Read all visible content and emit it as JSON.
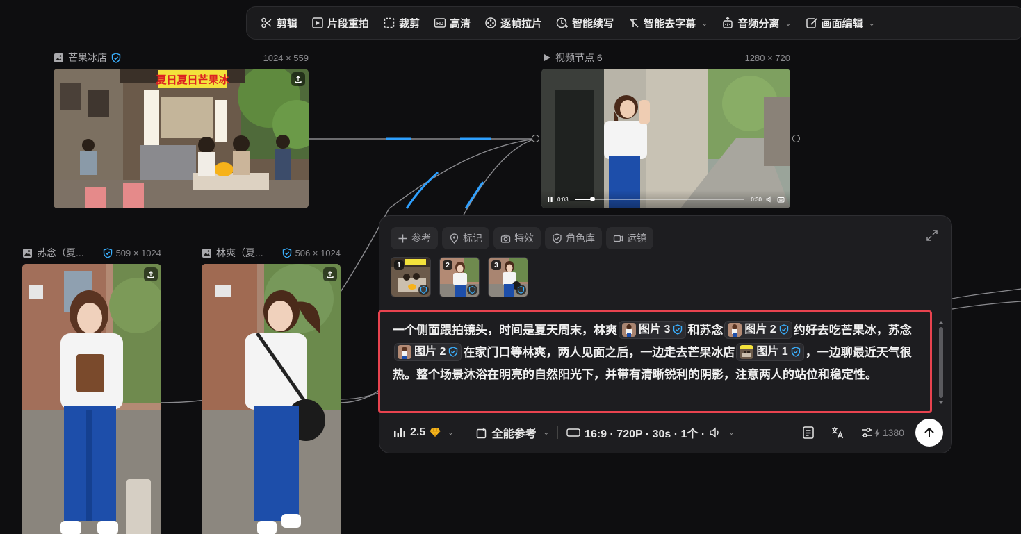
{
  "toolbar": {
    "items": [
      {
        "label": "剪辑",
        "icon": "scissors-icon"
      },
      {
        "label": "片段重拍",
        "icon": "reshoot-icon"
      },
      {
        "label": "裁剪",
        "icon": "crop-icon"
      },
      {
        "label": "高清",
        "icon": "hd-icon"
      },
      {
        "label": "逐帧拉片",
        "icon": "frame-icon"
      },
      {
        "label": "智能续写",
        "icon": "continue-icon"
      },
      {
        "label": "智能去字幕",
        "icon": "remove-subtitle-icon",
        "caret": "⌄"
      },
      {
        "label": "音频分离",
        "icon": "audio-separate-icon",
        "caret": "⌄"
      },
      {
        "label": "画面编辑",
        "icon": "edit-icon",
        "caret": "⌄"
      }
    ]
  },
  "nodes": {
    "mango_shop": {
      "title": "芒果冰店",
      "dims": "1024 × 559",
      "signage": "夏日夏日芒果冰"
    },
    "video": {
      "title": "视频节点 6",
      "dims": "1280 × 720",
      "time_current": "0:03",
      "time_total": "0:30",
      "progress": 0.1
    },
    "sunian": {
      "title": "苏念（夏...",
      "dims": "509 × 1024"
    },
    "linshuang": {
      "title": "林爽（夏...",
      "dims": "506 × 1024"
    }
  },
  "panel": {
    "chips": [
      {
        "label": "参考",
        "icon": "plus-icon"
      },
      {
        "label": "标记",
        "icon": "mark-icon"
      },
      {
        "label": "特效",
        "icon": "camera-icon"
      },
      {
        "label": "角色库",
        "icon": "shield-icon"
      },
      {
        "label": "运镜",
        "icon": "video-camera-icon"
      }
    ],
    "thumbs": [
      "1",
      "2",
      "3"
    ],
    "prompt": {
      "t1": "一个侧面跟拍镜头，时间是夏天周末，林爽",
      "r1": "图片 3",
      "t2": "和苏念",
      "r2": "图片 2",
      "t3": "约好去吃芒果冰，苏念",
      "r3": "图片 2",
      "t4": "在家门口等林爽，两人见面之后，一边走去芒果冰店",
      "r4": "图片 1",
      "t5": "，一边聊最近天气很热。整个场景沐浴在明亮的自然阳光下，并带有清晰锐利的阴影，注意两人的站位和稳定性。"
    },
    "model": {
      "label": "2.5",
      "caret": "⌄"
    },
    "reference_mode": {
      "label": "全能参考",
      "caret": "⌄"
    },
    "settings": {
      "label": "16:9 · 720P · 30s · 1个 ·",
      "caret": "⌄"
    },
    "credits": "1380"
  },
  "colors": {
    "accent": "#2ea0ff",
    "highlight_border": "#e8434f",
    "shield": "#3ab0ff"
  }
}
